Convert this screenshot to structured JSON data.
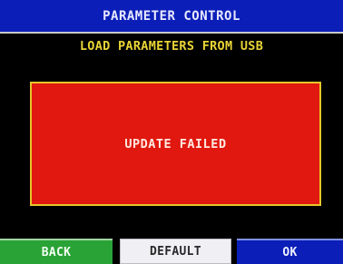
{
  "header": {
    "title": "PARAMETER CONTROL",
    "subtitle": "LOAD PARAMETERS FROM USB"
  },
  "status": {
    "message": "UPDATE FAILED"
  },
  "buttons": {
    "back_label": "BACK",
    "default_label": "DEFAULT",
    "ok_label": "OK"
  },
  "colors": {
    "title_bar": "#0b1fb8",
    "subtitle_text": "#e8d436",
    "status_panel": "#e0180f",
    "status_border": "#e6c62a",
    "back_button": "#2aa336",
    "default_button": "#efeff4",
    "ok_button": "#0b1fb8"
  }
}
